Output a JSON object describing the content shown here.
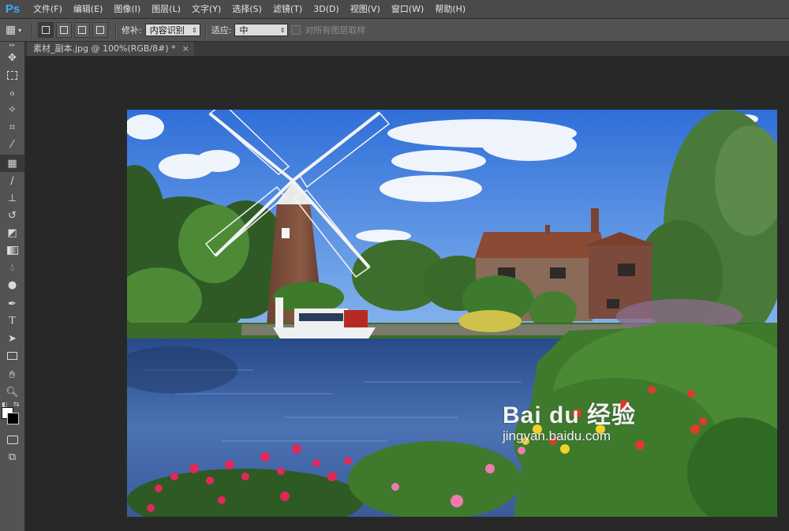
{
  "app": {
    "logo": "Ps"
  },
  "menu": [
    "文件(F)",
    "编辑(E)",
    "图像(I)",
    "图层(L)",
    "文字(Y)",
    "选择(S)",
    "滤镜(T)",
    "3D(D)",
    "视图(V)",
    "窗口(W)",
    "帮助(H)"
  ],
  "options": {
    "patch_label": "修补:",
    "patch_value": "内容识别",
    "adapt_label": "适应:",
    "adapt_value": "中",
    "sample_all_label": "对所有图层取样",
    "sample_all_checked": false
  },
  "document": {
    "tab_title": "素材_副本.jpg @ 100%(RGB/8#) *",
    "close_glyph": "×"
  },
  "tools": [
    "move-tool-icon",
    "marquee-tool-icon",
    "lasso-tool-icon",
    "magic-wand-tool-icon",
    "crop-tool-icon",
    "eyedropper-tool-icon",
    "patch-tool-icon",
    "brush-tool-icon",
    "clone-stamp-tool-icon",
    "history-brush-tool-icon",
    "eraser-tool-icon",
    "gradient-tool-icon",
    "blur-tool-icon",
    "dodge-tool-icon",
    "pen-tool-icon",
    "type-tool-icon",
    "path-selection-tool-icon",
    "rectangle-tool-icon",
    "hand-tool-icon",
    "zoom-tool-icon"
  ],
  "colors": {
    "foreground": "#ffffff",
    "background": "#000000",
    "accent": "#3fa9f5"
  },
  "watermark": {
    "title": "Bai du 经验",
    "url": "jingyan.baidu.com"
  }
}
